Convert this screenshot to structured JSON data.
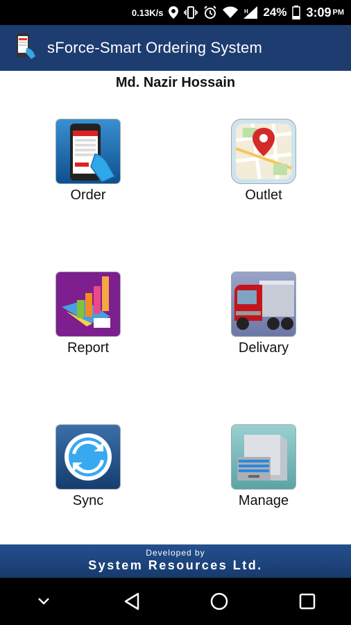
{
  "status_bar": {
    "net_speed": "0.13K/s",
    "battery_pct": "24%",
    "time": "3:09",
    "ampm": "PM",
    "icons": [
      "location-icon",
      "vibrate-icon",
      "alarm-icon",
      "wifi-icon",
      "signal-icon",
      "battery-icon"
    ]
  },
  "app_bar": {
    "title": "sForce-Smart Ordering System",
    "icon": "phone-app-icon"
  },
  "user": {
    "name": "Md. Nazir Hossain"
  },
  "tiles": [
    {
      "label": "Order",
      "icon": "order-phone-icon"
    },
    {
      "label": "Outlet",
      "icon": "map-pin-icon"
    },
    {
      "label": "Report",
      "icon": "report-chart-icon"
    },
    {
      "label": "Delivary",
      "icon": "truck-icon"
    },
    {
      "label": "Sync",
      "icon": "sync-icon"
    },
    {
      "label": "Manage",
      "icon": "cabinet-icon"
    }
  ],
  "footer": {
    "developed_by": "Developed by",
    "company": "System Resources Ltd."
  },
  "nav_bar": {
    "icons": [
      "chevron-down-icon",
      "back-icon",
      "home-icon",
      "recents-icon"
    ]
  },
  "colors": {
    "app_bar": "#1d3d70",
    "footer": "#1f4782",
    "status_bar": "#000000"
  }
}
